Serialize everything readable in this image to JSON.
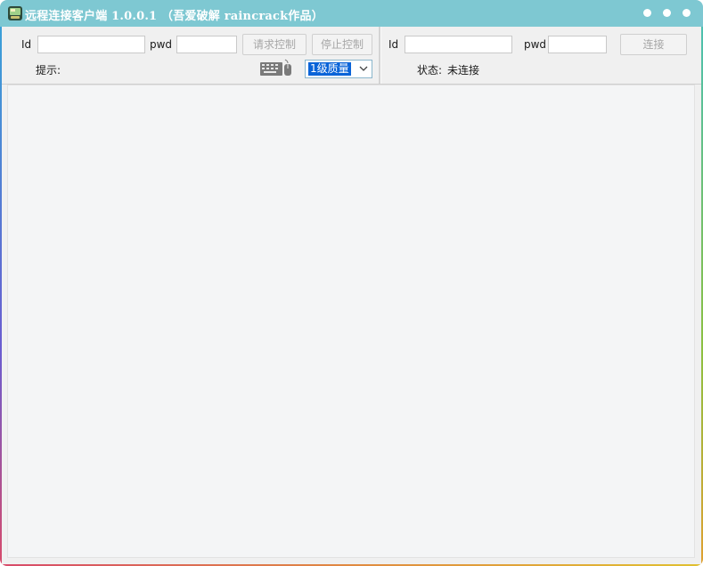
{
  "window": {
    "title": "远程连接客户端 1.0.0.1 （吾爱破解 raincrack作品）",
    "titlebar_color": "#7ec8d2",
    "controls": [
      "minimize-dot",
      "maximize-dot",
      "close-dot"
    ]
  },
  "controller": {
    "id_label": "Id",
    "id_value": "",
    "pwd_label": "pwd",
    "pwd_value": "",
    "request_control_label": "请求控制",
    "stop_control_label": "停止控制",
    "hint_label": "提示:",
    "keyboard_mouse_icon": "keyboard-mouse-icon",
    "quality": {
      "selected": "1级质量"
    }
  },
  "connection": {
    "id_label": "Id",
    "id_value": "",
    "pwd_label": "pwd",
    "pwd_value": "",
    "connect_label": "连接",
    "status_label": "状态:",
    "status_value": "未连接"
  },
  "colors": {
    "accent": "#7ec8d2",
    "selection": "#0a64d8",
    "disabled_text": "#a6a6a6"
  }
}
